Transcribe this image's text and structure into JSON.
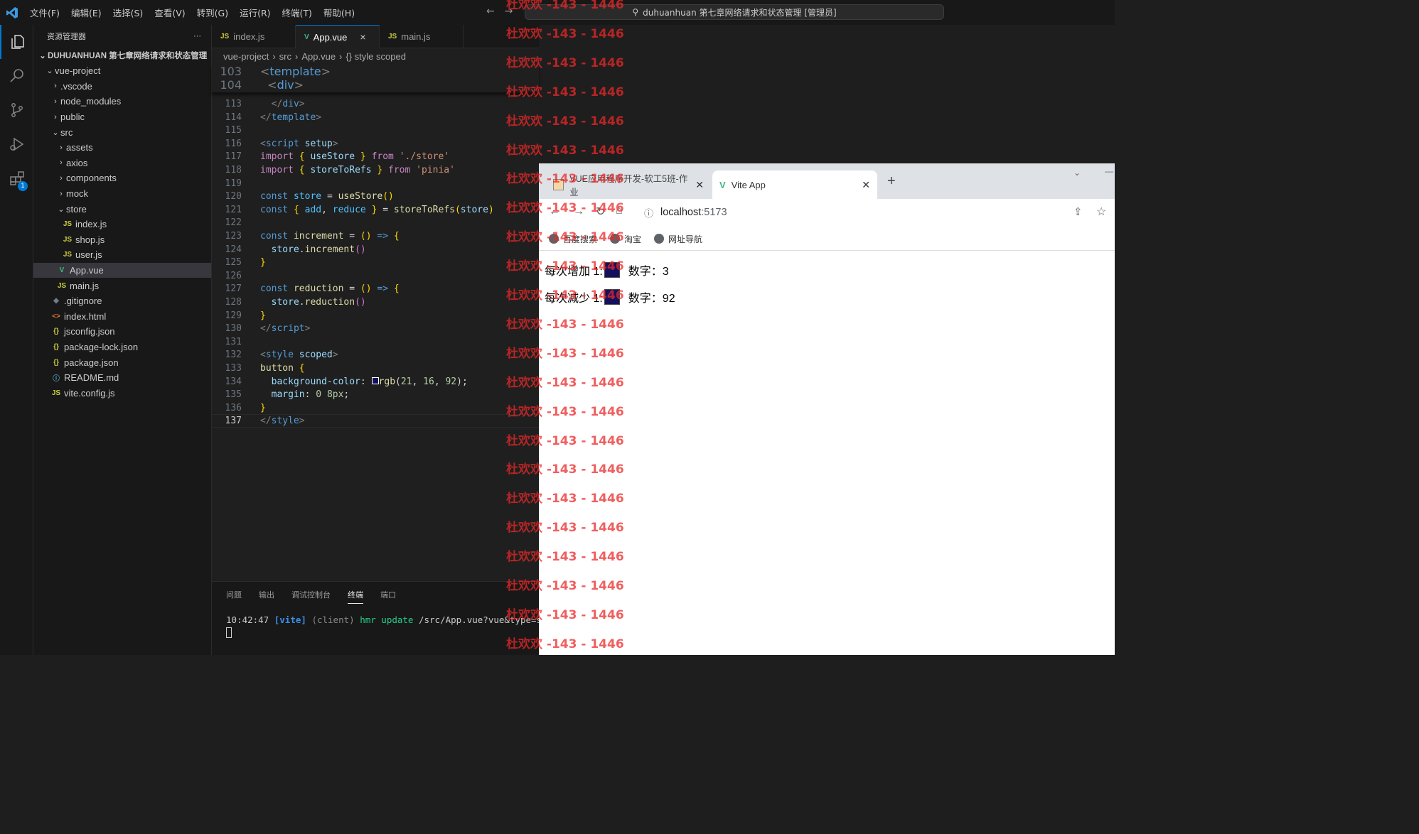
{
  "titlebar": {
    "menus": [
      "文件(F)",
      "编辑(E)",
      "选择(S)",
      "查看(V)",
      "转到(G)",
      "运行(R)",
      "终端(T)",
      "帮助(H)"
    ],
    "command_center": "duhuanhuan 第七章网络请求和状态管理 [管理员]"
  },
  "activity": {
    "extensions_badge": "1"
  },
  "sidebar": {
    "title": "资源管理器",
    "more": "···",
    "root": "DUHUANHUAN 第七章网络请求和状态管理",
    "items": [
      {
        "label": "vue-project",
        "depth": 1,
        "chev": "v",
        "icon": ""
      },
      {
        "label": ".vscode",
        "depth": 2,
        "chev": ">",
        "icon": ""
      },
      {
        "label": "node_modules",
        "depth": 2,
        "chev": ">",
        "icon": ""
      },
      {
        "label": "public",
        "depth": 2,
        "chev": ">",
        "icon": ""
      },
      {
        "label": "src",
        "depth": 2,
        "chev": "v",
        "icon": ""
      },
      {
        "label": "assets",
        "depth": 3,
        "chev": ">",
        "icon": ""
      },
      {
        "label": "axios",
        "depth": 3,
        "chev": ">",
        "icon": ""
      },
      {
        "label": "components",
        "depth": 3,
        "chev": ">",
        "icon": ""
      },
      {
        "label": "mock",
        "depth": 3,
        "chev": ">",
        "icon": ""
      },
      {
        "label": "store",
        "depth": 3,
        "chev": "v",
        "icon": ""
      },
      {
        "label": "index.js",
        "depth": 4,
        "chev": "",
        "icon": "JS"
      },
      {
        "label": "shop.js",
        "depth": 4,
        "chev": "",
        "icon": "JS"
      },
      {
        "label": "user.js",
        "depth": 4,
        "chev": "",
        "icon": "JS"
      },
      {
        "label": "App.vue",
        "depth": 3,
        "chev": "",
        "icon": "V",
        "selected": true
      },
      {
        "label": "main.js",
        "depth": 3,
        "chev": "",
        "icon": "JS"
      },
      {
        "label": ".gitignore",
        "depth": 2,
        "chev": "",
        "icon": "◆"
      },
      {
        "label": "index.html",
        "depth": 2,
        "chev": "",
        "icon": "<>"
      },
      {
        "label": "jsconfig.json",
        "depth": 2,
        "chev": "",
        "icon": "{}"
      },
      {
        "label": "package-lock.json",
        "depth": 2,
        "chev": "",
        "icon": "{}"
      },
      {
        "label": "package.json",
        "depth": 2,
        "chev": "",
        "icon": "{}"
      },
      {
        "label": "README.md",
        "depth": 2,
        "chev": "",
        "icon": "ⓘ"
      },
      {
        "label": "vite.config.js",
        "depth": 2,
        "chev": "",
        "icon": "JS"
      }
    ]
  },
  "editor": {
    "tabs": [
      {
        "label": "index.js",
        "icon": "JS"
      },
      {
        "label": "App.vue",
        "icon": "V",
        "active": true,
        "close": "×"
      },
      {
        "label": "main.js",
        "icon": "JS"
      }
    ],
    "breadcrumb": [
      "vue-project",
      "src",
      "App.vue",
      "{} style scoped"
    ],
    "sticky_lines": [
      {
        "n": "103",
        "html": "<span class='t'>&lt;</span><span class='k'>template</span><span class='t'>&gt;</span>"
      },
      {
        "n": "104",
        "html": "  <span class='t'>&lt;</span><span class='k'>div</span><span class='t'>&gt;</span>"
      }
    ],
    "lines": [
      {
        "n": "113",
        "html": "  <span class='t'>&lt;/</span><span class='k'>div</span><span class='t'>&gt;</span>"
      },
      {
        "n": "114",
        "html": "<span class='t'>&lt;/</span><span class='k'>template</span><span class='t'>&gt;</span>"
      },
      {
        "n": "115",
        "html": ""
      },
      {
        "n": "116",
        "html": "<span class='t'>&lt;</span><span class='k'>script</span> <span class='v'>setup</span><span class='t'>&gt;</span>"
      },
      {
        "n": "117",
        "html": "<span class='kw'>import</span> <span class='p'>{</span> <span class='v'>useStore</span> <span class='p'>}</span> <span class='kw'>from</span> <span class='s'>'./store'</span>"
      },
      {
        "n": "118",
        "html": "<span class='kw'>import</span> <span class='p'>{</span> <span class='v'>storeToRefs</span> <span class='p'>}</span> <span class='kw'>from</span> <span class='s'>'pinia'</span>"
      },
      {
        "n": "119",
        "html": ""
      },
      {
        "n": "120",
        "html": "<span class='k'>const</span> <span class='c'>store</span> <span class='w'>=</span> <span class='f'>useStore</span><span class='p'>()</span>"
      },
      {
        "n": "121",
        "html": "<span class='k'>const</span> <span class='p'>{</span> <span class='c'>add</span><span class='w'>,</span> <span class='c'>reduce</span> <span class='p'>}</span> <span class='w'>=</span> <span class='f'>storeToRefs</span><span class='p'>(</span><span class='v'>store</span><span class='p'>)</span>"
      },
      {
        "n": "122",
        "html": ""
      },
      {
        "n": "123",
        "html": "<span class='k'>const</span> <span class='f'>increment</span> <span class='w'>=</span> <span class='p'>()</span> <span class='k'>=&gt;</span> <span class='p'>{</span>"
      },
      {
        "n": "124",
        "html": "  <span class='v'>store</span><span class='w'>.</span><span class='f'>increment</span><span class='pp'>()</span>"
      },
      {
        "n": "125",
        "html": "<span class='p'>}</span>"
      },
      {
        "n": "126",
        "html": ""
      },
      {
        "n": "127",
        "html": "<span class='k'>const</span> <span class='f'>reduction</span> <span class='w'>=</span> <span class='p'>()</span> <span class='k'>=&gt;</span> <span class='p'>{</span>"
      },
      {
        "n": "128",
        "html": "  <span class='v'>store</span><span class='w'>.</span><span class='f'>reduction</span><span class='pp'>()</span>"
      },
      {
        "n": "129",
        "html": "<span class='p'>}</span>"
      },
      {
        "n": "130",
        "html": "<span class='t'>&lt;/</span><span class='k'>script</span><span class='t'>&gt;</span>"
      },
      {
        "n": "131",
        "html": ""
      },
      {
        "n": "132",
        "html": "<span class='t'>&lt;</span><span class='k'>style</span> <span class='v'>scoped</span><span class='t'>&gt;</span>"
      },
      {
        "n": "133",
        "html": "<span class='f'>button</span> <span class='p'>{</span>"
      },
      {
        "n": "134",
        "html": "  <span class='v'>background-color</span><span class='w'>:</span> <span style='display:inline-block;width:10px;height:10px;border:1px solid #fff;background:#15105c'></span><span class='f'>rgb</span><span class='w'>(</span><span class='n'>21</span><span class='w'>, </span><span class='n'>16</span><span class='w'>, </span><span class='n'>92</span><span class='w'>);</span>"
      },
      {
        "n": "135",
        "html": "  <span class='v'>margin</span><span class='w'>:</span> <span class='n'>0</span> <span class='n'>8px</span><span class='w'>;</span>"
      },
      {
        "n": "136",
        "html": "<span class='p'>}</span>"
      },
      {
        "n": "137",
        "html": "<span class='t'>&lt;/</span><span class='k'>style</span><span class='t'>&gt;</span>",
        "current": true
      }
    ]
  },
  "panel": {
    "tabs": [
      "问题",
      "输出",
      "调试控制台",
      "终端",
      "端口"
    ],
    "active_tab": "终端",
    "term_time": "10:42:47",
    "term_tag": "[vite]",
    "term_client": "(client)",
    "term_hmr": "hmr update",
    "term_path": "/src/App.vue?vue&type=styl"
  },
  "browser": {
    "tab1": "VUE应用程序开发-软工5班-作业",
    "tab2": "Vite App",
    "url_host": "localhost",
    "url_port": ":5173",
    "bookmarks": [
      "百度搜索",
      "淘宝",
      "网址导航"
    ],
    "row1_label": "每次增加 1:",
    "row1_value_label": "数字：3",
    "row2_label": "每次减少 1:",
    "row2_value_label": "数字：92"
  },
  "watermark": {
    "text": "杜欢欢 -143 - 1446"
  },
  "colors": {
    "accent": "#0078d4",
    "button_color": "#15105c",
    "watermark": "#eb2828"
  }
}
